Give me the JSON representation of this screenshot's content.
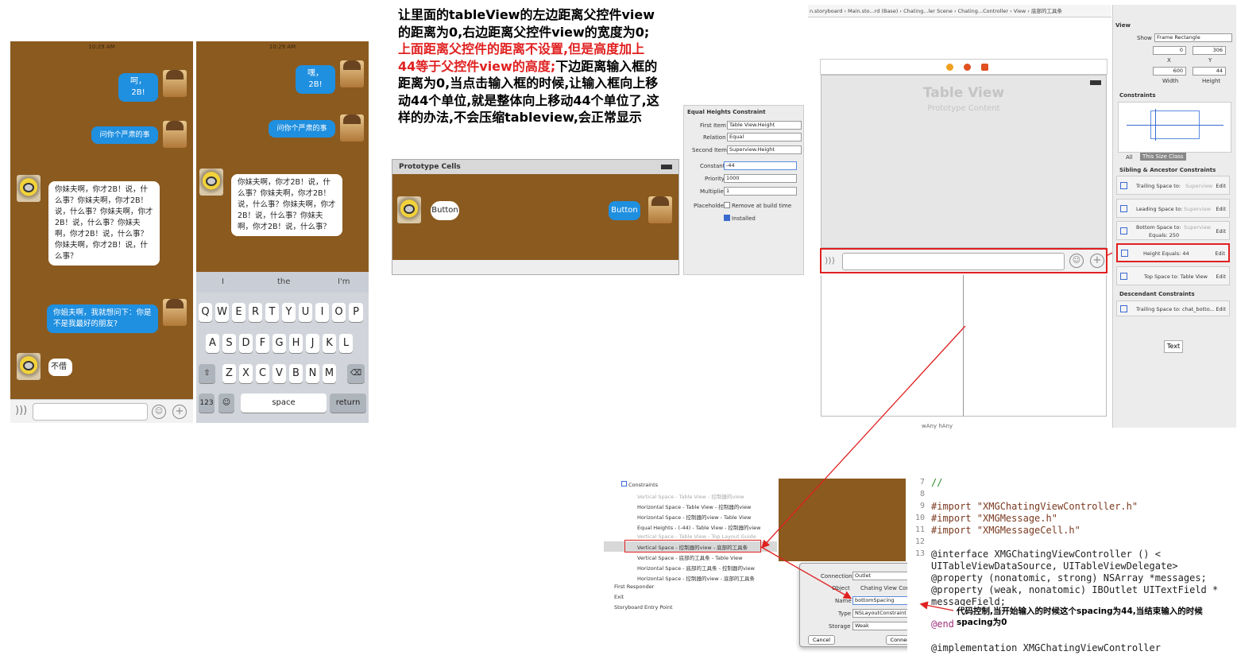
{
  "phone1": {
    "status": "10:29 AM",
    "messages": [
      "呵，2B!",
      "问你个严肃的事",
      "你妹夫啊，你才2B！说，什么事？你妹夫啊，你才2B！说，什么事？你妹夫啊，你才2B！说，什么事？你妹夫啊，你才2B！说，什么事？你妹夫啊，你才2B！说，什么事？",
      "你姐夫啊，我就想问下：你是不是我最好的朋友?",
      "不借"
    ]
  },
  "phone2": {
    "status": "10:29 AM",
    "messages": [
      "嘿，2B!",
      "问你个严肃的事",
      "你妹夫啊，你才2B！说，什么事？你妹夫啊，你才2B！说，什么事？你妹夫啊，你才2B！说，什么事？你妹夫啊，你才2B！说，什么事？"
    ],
    "suggestions": [
      "I",
      "the",
      "I'm"
    ],
    "row1": [
      "Q",
      "W",
      "E",
      "R",
      "T",
      "Y",
      "U",
      "I",
      "O",
      "P"
    ],
    "row2": [
      "A",
      "S",
      "D",
      "F",
      "G",
      "H",
      "J",
      "K",
      "L"
    ],
    "row3": [
      "Z",
      "X",
      "C",
      "V",
      "B",
      "N",
      "M"
    ],
    "k123": "123",
    "space": "space",
    "ret": "return"
  },
  "annotation": {
    "p1": "让里面的tableView的左边距离父控件view的距离为0,右边距离父控件view的宽度为0;",
    "p2": "上面距离父控件的距离不设置,但是高度加上44等于父控件view的高度;",
    "p3": "下边距离输入框的距离为0,当点击输入框的时候,让输入框向上移动44个单位,就是整体向上移动44个单位了,这样的办法,不会压缩tableview,会正常显示"
  },
  "proto": {
    "title": "Prototype Cells",
    "btn_left": "Button",
    "btn_right": "Button"
  },
  "eq": {
    "title": "Equal Heights Constraint",
    "first_item_l": "First Item",
    "first_item": "Table View.Height",
    "relation_l": "Relation",
    "relation": "Equal",
    "second_item_l": "Second Item",
    "second_item": "Superview.Height",
    "constant_l": "Constant",
    "constant": "-44",
    "priority_l": "Priority",
    "priority": "1000",
    "multiplier_l": "Multiplier",
    "multiplier": "1",
    "placeholder_l": "Placeholder",
    "placeholder": "Remove at build time",
    "installed": "Installed"
  },
  "xcode": {
    "crumbs": [
      "n.storyboard",
      "Main.sto...rd (Base)",
      "Chating...ler Scene",
      "Chating...Controller",
      "View",
      "底部的工具条"
    ],
    "tv_title": "Table View",
    "tv_sub": "Prototype Content",
    "size_class": "wAny hAny"
  },
  "inspector": {
    "view_l": "View",
    "show_l": "Show",
    "show": "Frame Rectangle",
    "x": "0",
    "y": "306",
    "x_l": "X",
    "y_l": "Y",
    "w": "600",
    "h": "44",
    "w_l": "Width",
    "h_l": "Height",
    "constraints_l": "Constraints",
    "tab_all": "All",
    "tab_size": "This Size Class",
    "sibling_l": "Sibling & Ancestor Constraints",
    "cells": [
      {
        "t": "Trailing Space to:",
        "s": "Superview"
      },
      {
        "t": "Leading Space to:",
        "s": "Superview"
      },
      {
        "t": "Bottom Space to:",
        "s": "Superview",
        "e": "Equals: 250"
      },
      {
        "t": "Height Equals: 44",
        "s": ""
      },
      {
        "t": "Top Space to: Table View",
        "s": ""
      }
    ],
    "edit": "Edit",
    "desc_l": "Descendant Constraints",
    "desc_cell": "Trailing Space to: chat_botto...",
    "text_btn": "Text"
  },
  "outline": {
    "head": "Constraints",
    "items": [
      "Vertical Space - Table View - 控制器的view",
      "Horizontal Space - Table View - 控制器的view",
      "Horizontal Space - 控制器的view - Table View",
      "Equal Heights - (-44) - Table View - 控制器的view",
      "Vertical Space - Table View - Top Layout Guide",
      "Vertical Space - 控制器的view - 底部的工具条",
      "Vertical Space - 底部的工具条 - Table View",
      "Horizontal Space - 底部的工具条 - 控制器的view",
      "Horizontal Space - 控制器的view - 底部的工具条"
    ],
    "first_responder": "First Responder",
    "exit": "Exit",
    "entry": "Storyboard Entry Point"
  },
  "connect": {
    "connection_l": "Connection",
    "connection": "Outlet",
    "object_l": "Object",
    "object": "Chating View Contr...",
    "name_l": "Name",
    "name": "bottomSpacing",
    "type_l": "Type",
    "type": "NSLayoutConstraint",
    "storage_l": "Storage",
    "storage": "Weak",
    "cancel": "Cancel",
    "connect": "Connect"
  },
  "code": {
    "lines": [
      {
        "n": "7",
        "t": "//"
      },
      {
        "n": "8",
        "t": ""
      },
      {
        "n": "9",
        "t": "#import \"XMGChatingViewController.h\""
      },
      {
        "n": "10",
        "t": "#import \"XMGMessage.h\""
      },
      {
        "n": "11",
        "t": "#import \"XMGMessageCell.h\""
      },
      {
        "n": "12",
        "t": ""
      },
      {
        "n": "13",
        "t": "@interface XMGChatingViewController () <"
      },
      {
        "n": "",
        "t": "    UITableViewDataSource, UITableViewDelegate>"
      },
      {
        "n": "",
        "t": "@property (nonatomic, strong) NSArray *messages;"
      },
      {
        "n": "",
        "t": "@property (weak, nonatomic) IBOutlet UITextField *"
      },
      {
        "n": "",
        "t": "    messageField;"
      },
      {
        "n": "",
        "t": "@end"
      },
      {
        "n": "",
        "t": ""
      },
      {
        "n": "",
        "t": "@implementation XMGChatingViewController"
      }
    ],
    "note": "代码控制,当开始输入的时候这个spacing为44,当结束输入的时候spacing为0"
  },
  "colors": {
    "brown": "#8b5a1f",
    "blue": "#1f8fe0",
    "red": "#e02020"
  }
}
